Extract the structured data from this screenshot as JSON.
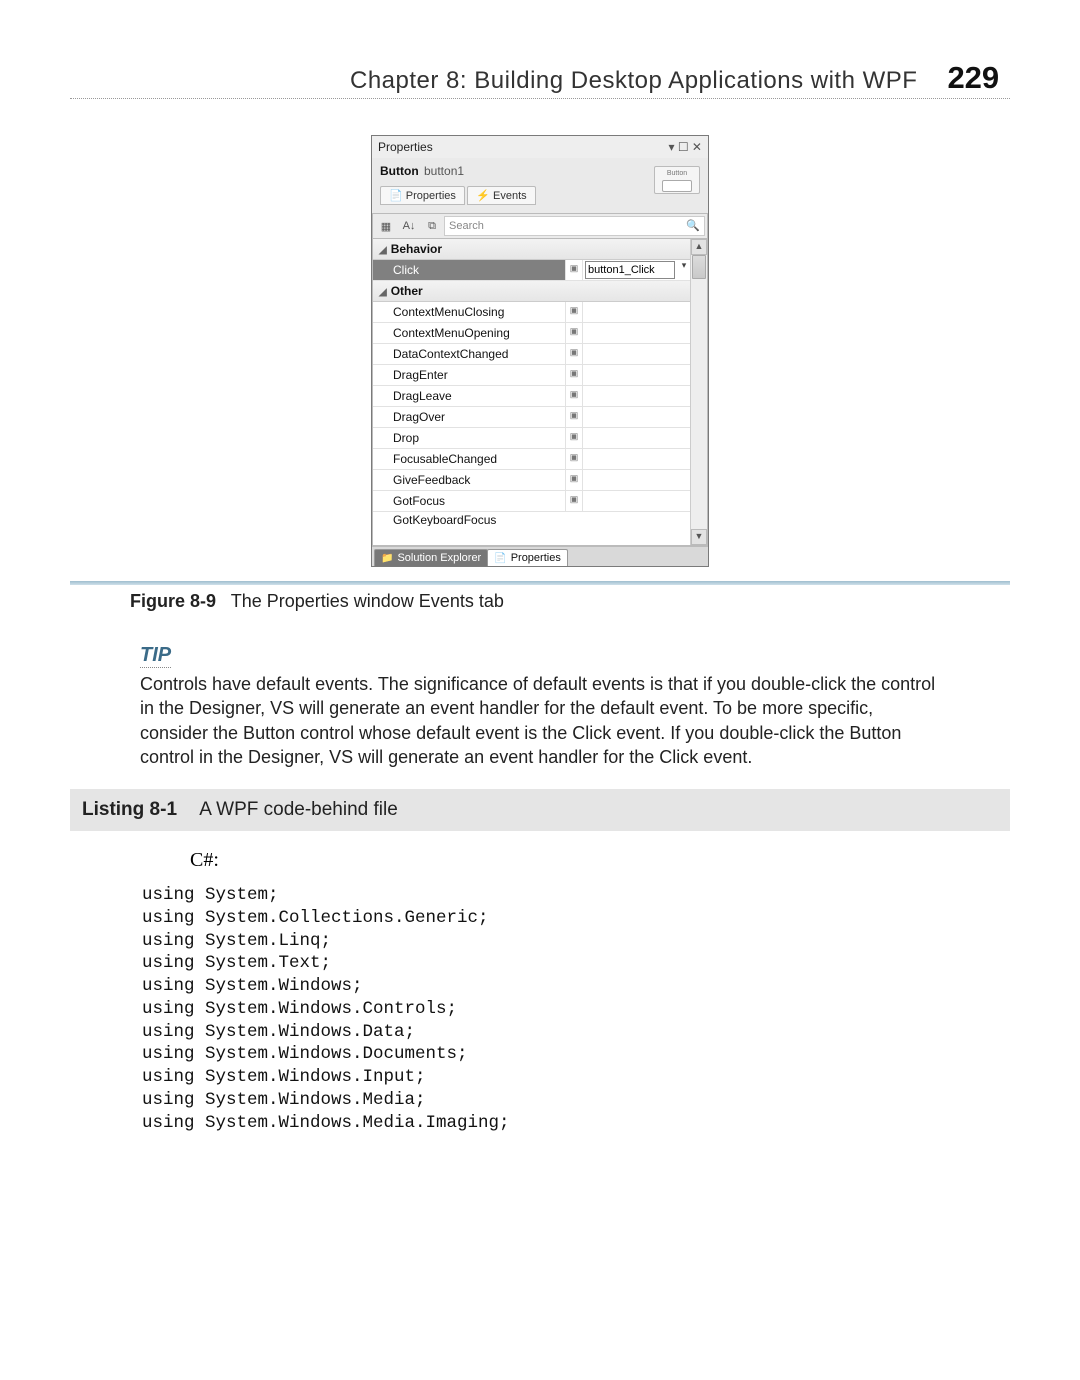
{
  "header": {
    "chapter_title": "Chapter 8:   Building Desktop Applications with WPF",
    "page_number": "229"
  },
  "props_window": {
    "title": "Properties",
    "title_icons": "▾ ☐ ✕",
    "object_type": "Button",
    "object_name": "button1",
    "preview_label": "Button",
    "tab_properties": "Properties",
    "tab_events": "Events",
    "search_placeholder": "Search",
    "search_glyph": "🔍",
    "category_behavior": "Behavior",
    "category_other": "Other",
    "behavior_event": "Click",
    "behavior_handler": "button1_Click",
    "other_events": [
      "ContextMenuClosing",
      "ContextMenuOpening",
      "DataContextChanged",
      "DragEnter",
      "DragLeave",
      "DragOver",
      "Drop",
      "FocusableChanged",
      "GiveFeedback",
      "GotFocus"
    ],
    "cutoff_event": "GotKeyboardFocus",
    "bottom_tab_solution": "Solution Explorer",
    "bottom_tab_properties": "Properties"
  },
  "figure": {
    "label": "Figure 8-9",
    "caption": "The Properties window Events tab"
  },
  "tip": {
    "label": "TIP",
    "text": "Controls have default events. The significance of default events is that if you double-click the control in the Designer, VS will generate an event handler for the default event. To be more specific, consider the Button control whose default event is the Click event. If you double-click the Button control in the Designer, VS will generate an event handler for the Click event."
  },
  "listing": {
    "label": "Listing 8-1",
    "title": "A WPF code-behind file",
    "language": "C#:",
    "code": "using System;\nusing System.Collections.Generic;\nusing System.Linq;\nusing System.Text;\nusing System.Windows;\nusing System.Windows.Controls;\nusing System.Windows.Data;\nusing System.Windows.Documents;\nusing System.Windows.Input;\nusing System.Windows.Media;\nusing System.Windows.Media.Imaging;"
  }
}
